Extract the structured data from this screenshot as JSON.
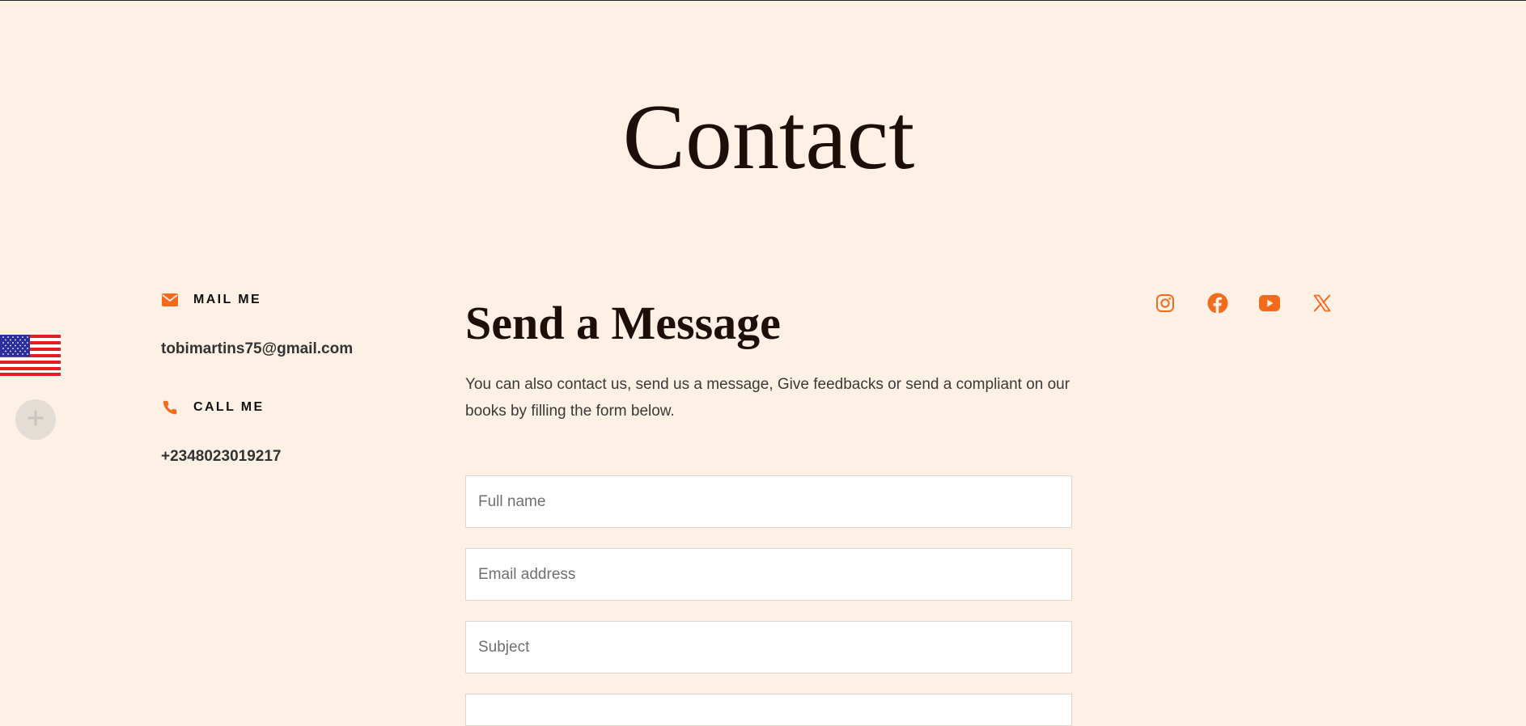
{
  "page": {
    "title": "Contact"
  },
  "contact": {
    "mail": {
      "label": "MAIL ME",
      "icon": "envelope-icon",
      "value": "tobimartins75@gmail.com"
    },
    "call": {
      "label": "CALL ME",
      "icon": "phone-icon",
      "value": "+2348023019217"
    }
  },
  "message": {
    "title": "Send a Message",
    "description": "You can also contact us, send us a message, Give feedbacks or send a compliant on our books by filling the form below.",
    "fields": {
      "full_name_placeholder": "Full name",
      "email_placeholder": "Email address",
      "subject_placeholder": "Subject"
    }
  },
  "social": {
    "icons": [
      "instagram-icon",
      "facebook-icon",
      "youtube-icon",
      "x-twitter-icon"
    ]
  },
  "widgets": {
    "language_flag": "us-flag-icon",
    "plus_icon": "plus-icon"
  },
  "colors": {
    "background": "#fdf0e4",
    "accent": "#f26b1d",
    "heading": "#1c0f0a"
  }
}
